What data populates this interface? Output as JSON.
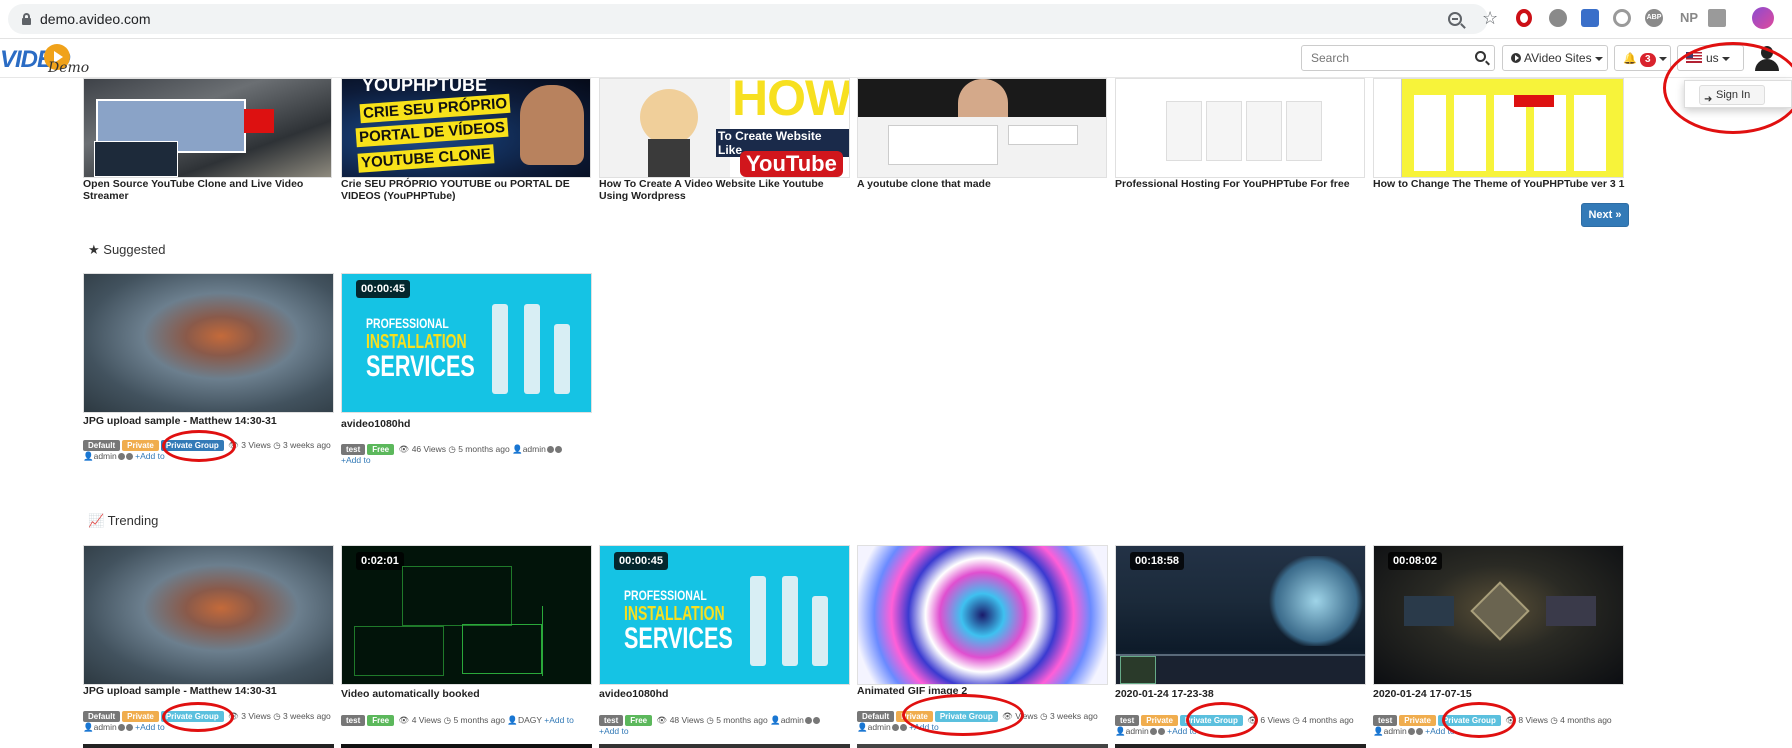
{
  "browser": {
    "url": "demo.avideo.com"
  },
  "navbar": {
    "logo_text": "VIDEO",
    "logo_subtext": "Demo",
    "search_placeholder": "Search",
    "sites_label": "AVideo Sites",
    "notification_count": "3",
    "language_label": "us",
    "signin_label": "Sign In"
  },
  "top_row": {
    "videos": [
      {
        "title": "Open Source YouTube Clone and Live Video Streamer"
      },
      {
        "title": "Crie SEU PRÓPRIO YOUTUBE ou PORTAL DE VIDEOS (YouPHPTube)",
        "overlay": [
          "YOUPHPTUBE",
          "CRIE SEU PRÓPRIO",
          "PORTAL DE VÍDEOS",
          "YOUTUBE CLONE"
        ]
      },
      {
        "title": "How To Create A Video Website Like Youtube Using Wordpress",
        "overlay": [
          "HOW",
          "To Create Website Like",
          "YouTube"
        ]
      },
      {
        "title": "A youtube clone that made"
      },
      {
        "title": "Professional Hosting For YouPHPTube For free"
      },
      {
        "title": "How to Change The Theme of YouPHPTube ver 3 1"
      }
    ],
    "next_label": "Next"
  },
  "suggested": {
    "heading": "Suggested",
    "videos": [
      {
        "title": "JPG upload sample - Matthew 14:30-31",
        "labels": [
          {
            "text": "Default",
            "color": "gray"
          },
          {
            "text": "Private",
            "color": "orange"
          },
          {
            "text": "Private Group",
            "color": "blue"
          }
        ],
        "views": "3 Views",
        "time": "3 weeks ago",
        "user": "admin",
        "add_to": "Add to"
      },
      {
        "title": "avideo1080hd",
        "duration": "00:00:45",
        "labels": [
          {
            "text": "test",
            "color": "gray"
          },
          {
            "text": "Free",
            "color": "green"
          }
        ],
        "views": "46 Views",
        "time": "5 months ago",
        "user": "admin",
        "add_to": "Add to"
      }
    ]
  },
  "trending": {
    "heading": "Trending",
    "videos": [
      {
        "title": "JPG upload sample - Matthew 14:30-31",
        "labels": [
          {
            "text": "Default",
            "color": "gray"
          },
          {
            "text": "Private",
            "color": "orange"
          },
          {
            "text": "Private Group",
            "color": "cyan"
          }
        ],
        "views": "3 Views",
        "time": "3 weeks ago",
        "user": "admin",
        "add_to": "Add to"
      },
      {
        "title": "Video automatically booked",
        "duration": "0:02:01",
        "labels": [
          {
            "text": "test",
            "color": "gray"
          },
          {
            "text": "Free",
            "color": "green"
          }
        ],
        "views": "4 Views",
        "time": "5 months ago",
        "user": "DAGY",
        "add_to": "Add to"
      },
      {
        "title": "avideo1080hd",
        "duration": "00:00:45",
        "labels": [
          {
            "text": "test",
            "color": "gray"
          },
          {
            "text": "Free",
            "color": "green"
          }
        ],
        "views": "48 Views",
        "time": "5 months ago",
        "user": "admin",
        "add_to": "Add to"
      },
      {
        "title": "Animated GIF image 2",
        "labels": [
          {
            "text": "Default",
            "color": "gray"
          },
          {
            "text": "Private",
            "color": "orange"
          },
          {
            "text": "Private Group",
            "color": "cyan"
          }
        ],
        "views": "Views",
        "time": "3 weeks ago",
        "user": "admin",
        "add_to": "Add to"
      },
      {
        "title": "2020-01-24 17-23-38",
        "duration": "00:18:58",
        "labels": [
          {
            "text": "test",
            "color": "gray"
          },
          {
            "text": "Private",
            "color": "orange"
          },
          {
            "text": "Private Group",
            "color": "cyan"
          }
        ],
        "views": "6 Views",
        "time": "4 months ago",
        "user": "admin",
        "add_to": "Add to"
      },
      {
        "title": "2020-01-24 17-07-15",
        "duration": "00:08:02",
        "labels": [
          {
            "text": "test",
            "color": "gray"
          },
          {
            "text": "Private",
            "color": "orange"
          },
          {
            "text": "Private Group",
            "color": "cyan"
          }
        ],
        "views": "8 Views",
        "time": "4 months ago",
        "user": "admin",
        "add_to": "Add to"
      }
    ]
  },
  "thumb_overlays": {
    "pro_line1": "PROFESSIONAL",
    "pro_line2": "INSTALLATION",
    "pro_line3": "SERVICES"
  }
}
